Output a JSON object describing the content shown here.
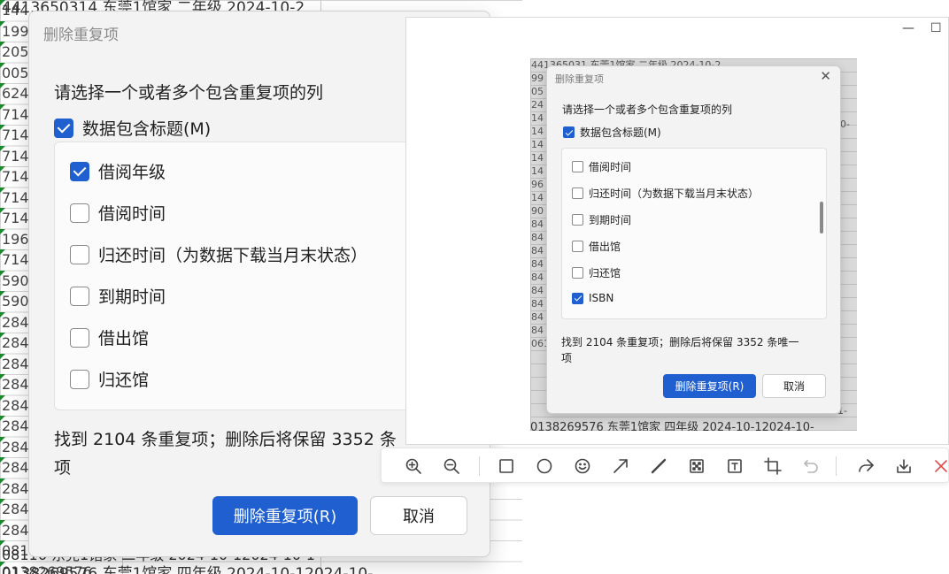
{
  "spreadsheet": {
    "top_row": "4413650314 东莞1馆家 二年级 2024-10-2",
    "left_cells": [
      "144",
      "199",
      "205",
      "005",
      "624",
      "714",
      "714",
      "714",
      "714",
      "714",
      "714",
      "196",
      "714",
      "590",
      "590",
      "284",
      "284",
      "284",
      "284",
      "284",
      "284",
      "284",
      "284",
      "284",
      "284",
      "284",
      "081",
      "0138269576"
    ],
    "bottom_rows": [
      "08116 东莞1馆家 二年级 2024-10-12024-10-1",
      "0138269576 东莞1馆家 四年级 2024-10-12024-10-"
    ]
  },
  "dialog": {
    "title": "删除重复项",
    "prompt": "请选择一个或者多个包含重复项的列",
    "header_checkbox": {
      "label": "数据包含标题(M)",
      "checked": true
    },
    "columns": [
      {
        "label": "借阅年级",
        "checked": true
      },
      {
        "label": "借阅时间",
        "checked": false
      },
      {
        "label": "归还时间（为数据下载当月末状态）",
        "checked": false
      },
      {
        "label": "到期时间",
        "checked": false
      },
      {
        "label": "借出馆",
        "checked": false
      },
      {
        "label": "归还馆",
        "checked": false
      }
    ],
    "status_line1": "找到 2104 条重复项；删除后将保留 3352 条",
    "status_line2": "项",
    "ok_label": "删除重复项(R)",
    "cancel_label": "取消"
  },
  "preview": {
    "window_controls": {
      "minimize": "—",
      "maximize": "☐"
    },
    "mini_cells": [
      "441365031 东莞1馆家 二年级  2024-10-2",
      "99",
      "05",
      "24",
      "14",
      "14",
      "14",
      "14",
      "14",
      "96",
      "14",
      "90",
      "84",
      "84",
      "84",
      "84",
      "84",
      "84",
      "84",
      "84",
      "84",
      "061"
    ],
    "mini_right_fragments": [
      "0-",
      "0-",
      "0-",
      "0-",
      "01-"
    ],
    "mini_bottom": "0138269576 东莞1馆家 四年级   2024-10-12024-10-",
    "dialog": {
      "title": "删除重复项",
      "close": "✕",
      "prompt": "请选择一个或者多个包含重复项的列",
      "header_checkbox": {
        "label": "数据包含标题(M)",
        "checked": true
      },
      "columns": [
        {
          "label": "借阅时间",
          "checked": false
        },
        {
          "label": "归还时间（为数据下载当月末状态）",
          "checked": false
        },
        {
          "label": "到期时间",
          "checked": false
        },
        {
          "label": "借出馆",
          "checked": false
        },
        {
          "label": "归还馆",
          "checked": false
        },
        {
          "label": "ISBN",
          "checked": true
        }
      ],
      "status_line1": "找到 2104 条重复项；删除后将保留 3352 条唯一",
      "status_line2": "项",
      "ok_label": "删除重复项(R)",
      "cancel_label": "取消"
    }
  },
  "toolbar": {
    "icons": [
      "zoom-in-icon",
      "zoom-out-icon",
      "rectangle-icon",
      "circle-icon",
      "emoji-icon",
      "arrow-icon",
      "line-icon",
      "mosaic-icon",
      "text-icon",
      "crop-icon",
      "undo-icon",
      "share-icon",
      "download-icon",
      "close-icon"
    ],
    "accent_close": "#e24a4a"
  },
  "colors": {
    "primary": "#1f5fd0",
    "dialog_bg": "#f3f3f3"
  }
}
